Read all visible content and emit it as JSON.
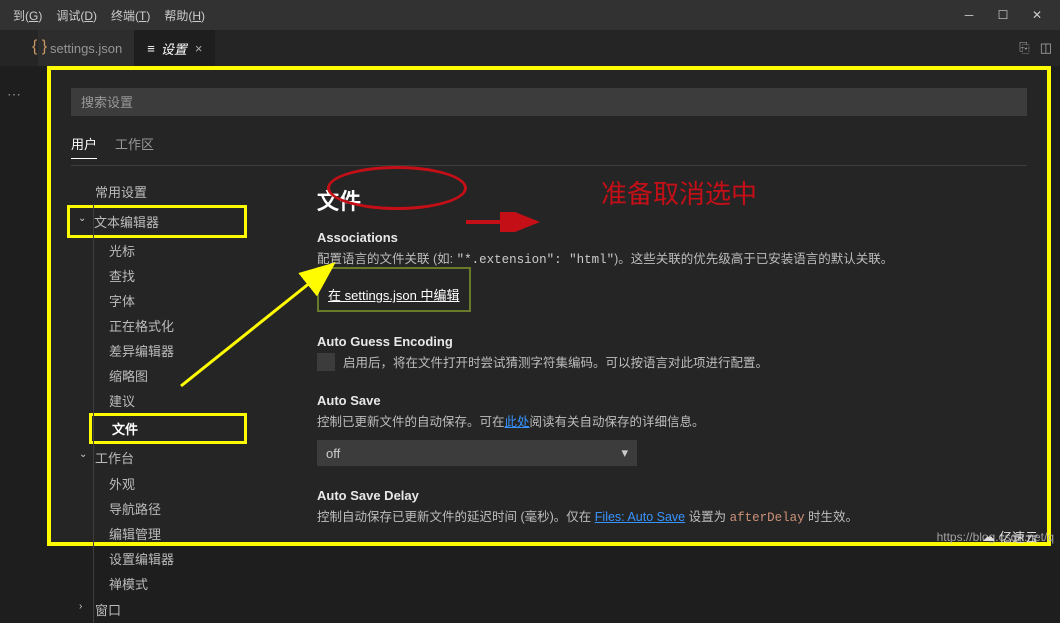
{
  "menubar": {
    "items": [
      {
        "label": "到(G)",
        "accel": "G"
      },
      {
        "label": "调试(D)",
        "accel": "D"
      },
      {
        "label": "终端(T)",
        "accel": "T"
      },
      {
        "label": "帮助(H)",
        "accel": "H"
      }
    ]
  },
  "tabs": {
    "file_tab": "settings.json",
    "settings_tab": "设置"
  },
  "search": {
    "placeholder": "搜索设置"
  },
  "scope": {
    "user": "用户",
    "workspace": "工作区"
  },
  "sidebar": {
    "common": "常用设置",
    "text_editor": "文本编辑器",
    "subs": [
      "光标",
      "查找",
      "字体",
      "正在格式化",
      "差异编辑器",
      "缩略图",
      "建议",
      "文件"
    ],
    "workbench": "工作台",
    "wb_subs": [
      "外观",
      "导航路径",
      "编辑管理",
      "设置编辑器",
      "禅模式"
    ],
    "window": "窗口"
  },
  "section": {
    "heading": "文件"
  },
  "assoc": {
    "label": "Associations",
    "desc_before": "配置语言的文件关联 (如: ",
    "desc_code": "\"*.extension\": \"html\"",
    "desc_after": ")。这些关联的优先级高于已安装语言的默认关联。",
    "edit_link": "在 settings.json 中编辑"
  },
  "autoguess": {
    "label": "Auto Guess Encoding",
    "desc": "启用后，将在文件打开时尝试猜测字符集编码。可以按语言对此项进行配置。"
  },
  "autosave": {
    "label": "Auto Save",
    "desc_before": "控制已更新文件的自动保存。可在",
    "link": "此处",
    "desc_after": "阅读有关自动保存的详细信息。",
    "value": "off"
  },
  "autosavedelay": {
    "label": "Auto Save Delay",
    "desc_before": "控制自动保存已更新文件的延迟时间 (毫秒)。仅在 ",
    "link": "Files: Auto Save",
    "desc_mid": " 设置为 ",
    "code": "afterDelay",
    "desc_after": " 时生效。"
  },
  "annotations": {
    "red_text": "准备取消选中"
  },
  "watermark": "https://blog.csdn.net/q",
  "brand": "亿速云"
}
